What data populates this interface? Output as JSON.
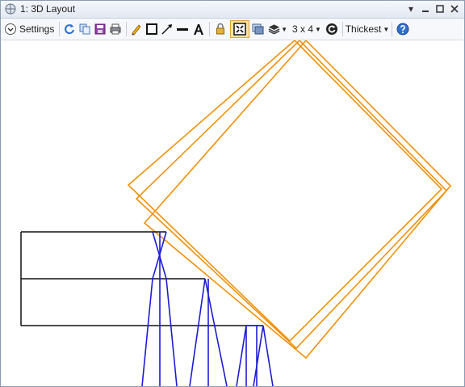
{
  "window": {
    "title": "1: 3D Layout"
  },
  "toolbar": {
    "settings_label": "Settings",
    "configuration": "3 x 4",
    "ray_thickness": "Thickest",
    "icons": [
      "chevron-down-circle-icon",
      "refresh-icon",
      "copy-icon",
      "save-icon",
      "print-icon",
      "pencil-icon",
      "rectangle-icon",
      "arrow-icon",
      "line-icon",
      "text-icon",
      "lock-icon",
      "fit-icon",
      "window-icon",
      "layers-icon",
      "rotate-icon",
      "help-icon"
    ]
  },
  "colors": {
    "lens_outline": "#f0900a",
    "rays": "#1c1cd4",
    "system_lines": "#111111"
  }
}
